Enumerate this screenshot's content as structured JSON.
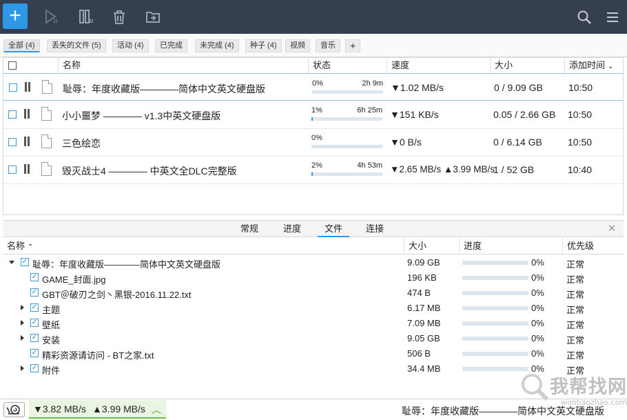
{
  "toolbar": {
    "icons": [
      "add-icon",
      "play-icon",
      "columns-icon",
      "trash-icon",
      "folder-icon",
      "search-icon",
      "menu-icon"
    ]
  },
  "filters": [
    {
      "label": "全部 (4)",
      "active": true
    },
    {
      "label": "丢失的文件 (5)"
    },
    {
      "label": "活动 (4)"
    },
    {
      "label": "已完成"
    },
    {
      "label": "未完成 (4)"
    },
    {
      "label": "种子 (4)"
    },
    {
      "label": "视频"
    },
    {
      "label": "音乐"
    },
    {
      "label": "+"
    }
  ],
  "columns": {
    "name": "名称",
    "status": "状态",
    "speed": "速度",
    "size": "大小",
    "added": "添加时间"
  },
  "torrents": [
    {
      "name": "耻辱：年度收藏版————简体中文英文硬盘版",
      "pct": "0%",
      "eta": "2h 9m",
      "progress": 0,
      "speed": "▼1.02 MB/s",
      "size": "0 / 9.09 GB",
      "added": "10:50",
      "selected": true
    },
    {
      "name": "小小噩梦 ———— v1.3中英文硬盘版",
      "pct": "1%",
      "eta": "6h 25m",
      "progress": 0.01,
      "speed": "▼151 KB/s",
      "size": "0.05 / 2.66 GB",
      "added": "10:50"
    },
    {
      "name": "三色绘恋",
      "pct": "0%",
      "eta": "",
      "progress": 0,
      "speed": "▼0 B/s",
      "size": "0 / 6.14 GB",
      "added": "10:50"
    },
    {
      "name": "毁灭战士4 ———— 中英文全DLC完整版",
      "pct": "2%",
      "eta": "4h 53m",
      "progress": 0.02,
      "speed": "▼2.65 MB/s ▲3.99 MB/s",
      "size": "1 / 52 GB",
      "added": "10:40"
    }
  ],
  "detail_tabs": [
    "常规",
    "进度",
    "文件",
    "连接"
  ],
  "files_header": {
    "name": "名称",
    "size": "大小",
    "progress": "进度",
    "priority": "优先级"
  },
  "files": [
    {
      "name": "耻辱：年度收藏版————简体中文英文硬盘版",
      "size": "9.09 GB",
      "pct": "0%",
      "priority": "正常",
      "level": 0,
      "expand": "down"
    },
    {
      "name": "GAME_封面.jpg",
      "size": "196 KB",
      "pct": "0%",
      "priority": "正常",
      "level": 1,
      "expand": ""
    },
    {
      "name": "GBT＠破刃之剑丶黑银-2016.11.22.txt",
      "size": "474 B",
      "pct": "0%",
      "priority": "正常",
      "level": 1,
      "expand": ""
    },
    {
      "name": "主题",
      "size": "6.17 MB",
      "pct": "0%",
      "priority": "正常",
      "level": 1,
      "expand": "right"
    },
    {
      "name": "壁纸",
      "size": "7.09 MB",
      "pct": "0%",
      "priority": "正常",
      "level": 1,
      "expand": "right"
    },
    {
      "name": "安装",
      "size": "9.05 GB",
      "pct": "0%",
      "priority": "正常",
      "level": 1,
      "expand": "right"
    },
    {
      "name": "精彩资源请访问 - BT之家.txt",
      "size": "506 B",
      "pct": "0%",
      "priority": "正常",
      "level": 1,
      "expand": ""
    },
    {
      "name": "附件",
      "size": "34.4 MB",
      "pct": "0%",
      "priority": "正常",
      "level": 1,
      "expand": "right"
    }
  ],
  "status": {
    "down": "▼3.82 MB/s",
    "up": "▲3.99 MB/s",
    "selected_name": "耻辱：年度收藏版————简体中文英文硬盘版"
  },
  "watermark": {
    "main": "我帮找网",
    "sub": "woobaozhao.com"
  },
  "colors": {
    "toolbar": "#363f4f",
    "accent": "#2f98e6",
    "speed_ok": "#6cbb3c"
  }
}
